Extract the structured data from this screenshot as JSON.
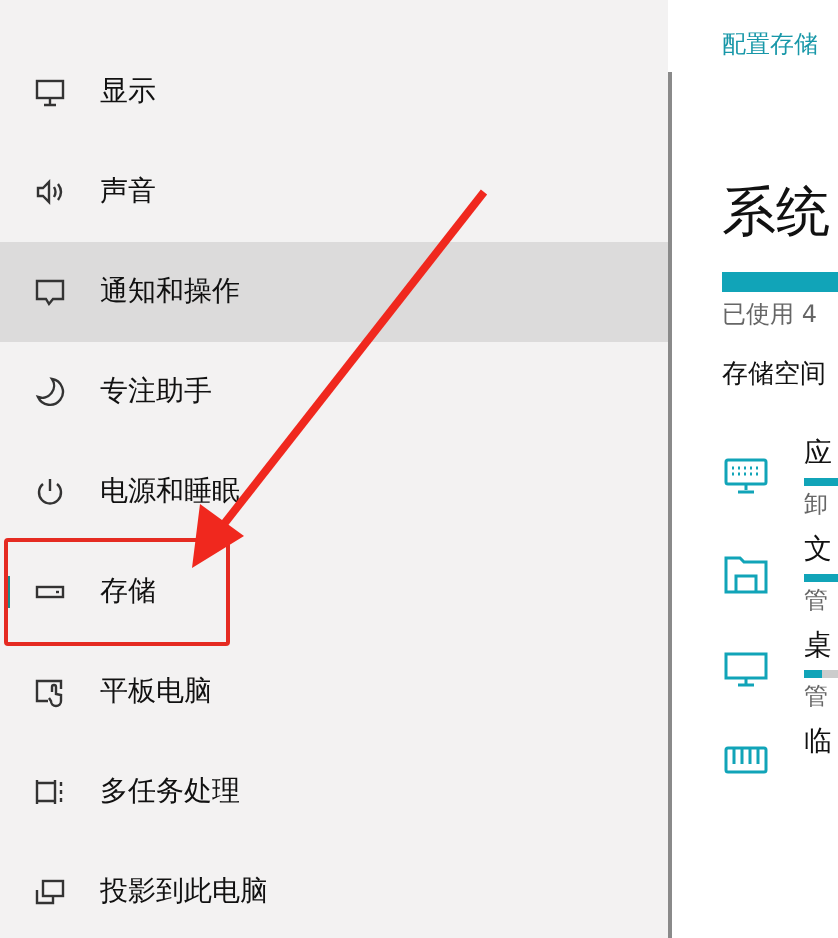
{
  "sidebar": {
    "items": [
      {
        "label": "显示",
        "selected": false,
        "hovered": false
      },
      {
        "label": "声音",
        "selected": false,
        "hovered": false
      },
      {
        "label": "通知和操作",
        "selected": false,
        "hovered": true
      },
      {
        "label": "专注助手",
        "selected": false,
        "hovered": false
      },
      {
        "label": "电源和睡眠",
        "selected": false,
        "hovered": false
      },
      {
        "label": "存储",
        "selected": true,
        "hovered": false
      },
      {
        "label": "平板电脑",
        "selected": false,
        "hovered": false
      },
      {
        "label": "多任务处理",
        "selected": false,
        "hovered": false
      },
      {
        "label": "投影到此电脑",
        "selected": false,
        "hovered": false
      }
    ]
  },
  "annotation": {
    "box_around_selected": true,
    "arrow": true
  },
  "main": {
    "link": "配置存储",
    "title": "系统",
    "usage": {
      "level": 1,
      "text": "已使用 4"
    },
    "section": "存储空间",
    "categories": [
      {
        "name": "应",
        "level": 1,
        "detail": "卸"
      },
      {
        "name": "文",
        "level": 1,
        "detail": "管"
      },
      {
        "name": "桌",
        "level": 0.55,
        "detail": "管"
      },
      {
        "name": "临"
      }
    ]
  }
}
